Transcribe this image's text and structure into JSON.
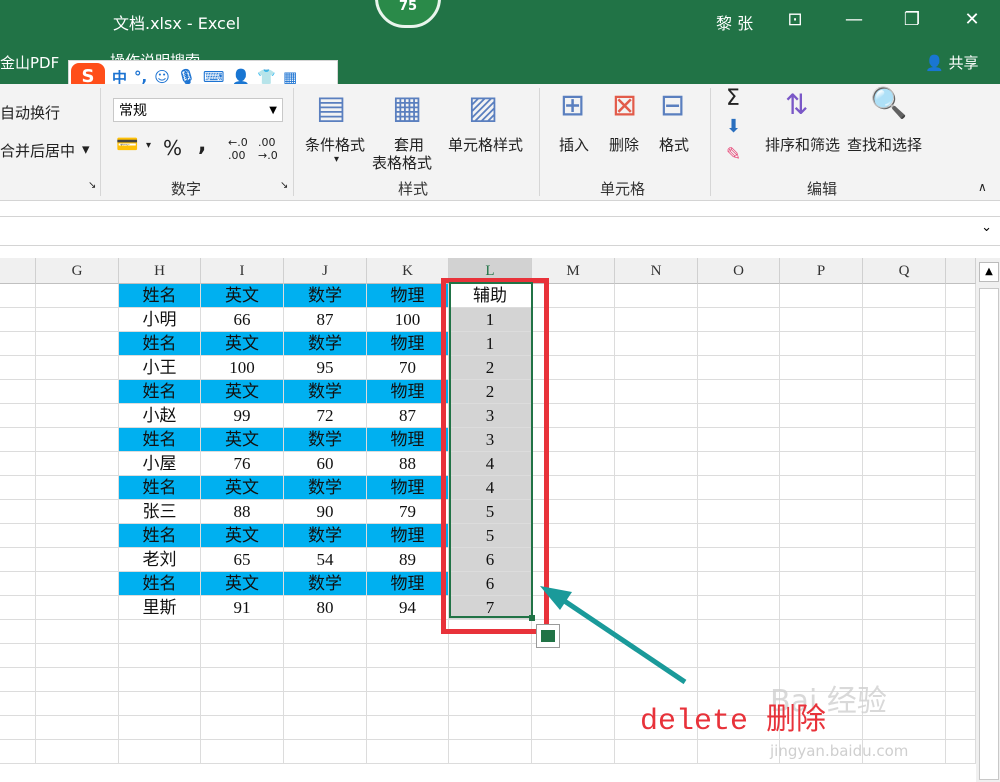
{
  "window": {
    "title": "文档.xlsx  -  Excel",
    "user": "黎 张",
    "badge": "75"
  },
  "menubar": {
    "pdf": "金山PDF",
    "tell": "操作说明搜索",
    "share": "共享"
  },
  "ime": {
    "logo": "S",
    "mode": "中",
    "punct": "°,"
  },
  "ribbon": {
    "wrap": "自动换行",
    "merge": "合并后居中",
    "number_format": "常规",
    "percent": "%",
    "comma": ",",
    "dec_inc": ".00",
    "dec_dec": ".0",
    "cond_format": "条件格式",
    "table_format_1": "套用",
    "table_format_2": "表格格式",
    "cell_style": "单元格样式",
    "insert": "插入",
    "delete": "删除",
    "format": "格式",
    "sort_filter": "排序和筛选",
    "find_select": "查找和选择",
    "group_number": "数字",
    "group_style": "样式",
    "group_cells": "单元格",
    "group_edit": "编辑"
  },
  "columns": [
    "G",
    "H",
    "I",
    "J",
    "K",
    "L",
    "M",
    "N",
    "O",
    "P",
    "Q"
  ],
  "rows": [
    [
      "姓名",
      "英文",
      "数学",
      "物理",
      "辅助"
    ],
    [
      "小明",
      "66",
      "87",
      "100",
      "1"
    ],
    [
      "姓名",
      "英文",
      "数学",
      "物理",
      "1"
    ],
    [
      "小王",
      "100",
      "95",
      "70",
      "2"
    ],
    [
      "姓名",
      "英文",
      "数学",
      "物理",
      "2"
    ],
    [
      "小赵",
      "99",
      "72",
      "87",
      "3"
    ],
    [
      "姓名",
      "英文",
      "数学",
      "物理",
      "3"
    ],
    [
      "小屋",
      "76",
      "60",
      "88",
      "4"
    ],
    [
      "姓名",
      "英文",
      "数学",
      "物理",
      "4"
    ],
    [
      "张三",
      "88",
      "90",
      "79",
      "5"
    ],
    [
      "姓名",
      "英文",
      "数学",
      "物理",
      "5"
    ],
    [
      "老刘",
      "65",
      "54",
      "89",
      "6"
    ],
    [
      "姓名",
      "英文",
      "数学",
      "物理",
      "6"
    ],
    [
      "里斯",
      "91",
      "80",
      "94",
      "7"
    ]
  ],
  "annotation": "delete  删除",
  "watermark": {
    "main": "Bai 经验",
    "url": "jingyan.baidu.com"
  },
  "colors": {
    "excel_green": "#217346",
    "header_blue": "#00b0f0",
    "highlight_red": "#e8323a",
    "arrow_teal": "#1a9a9a"
  }
}
